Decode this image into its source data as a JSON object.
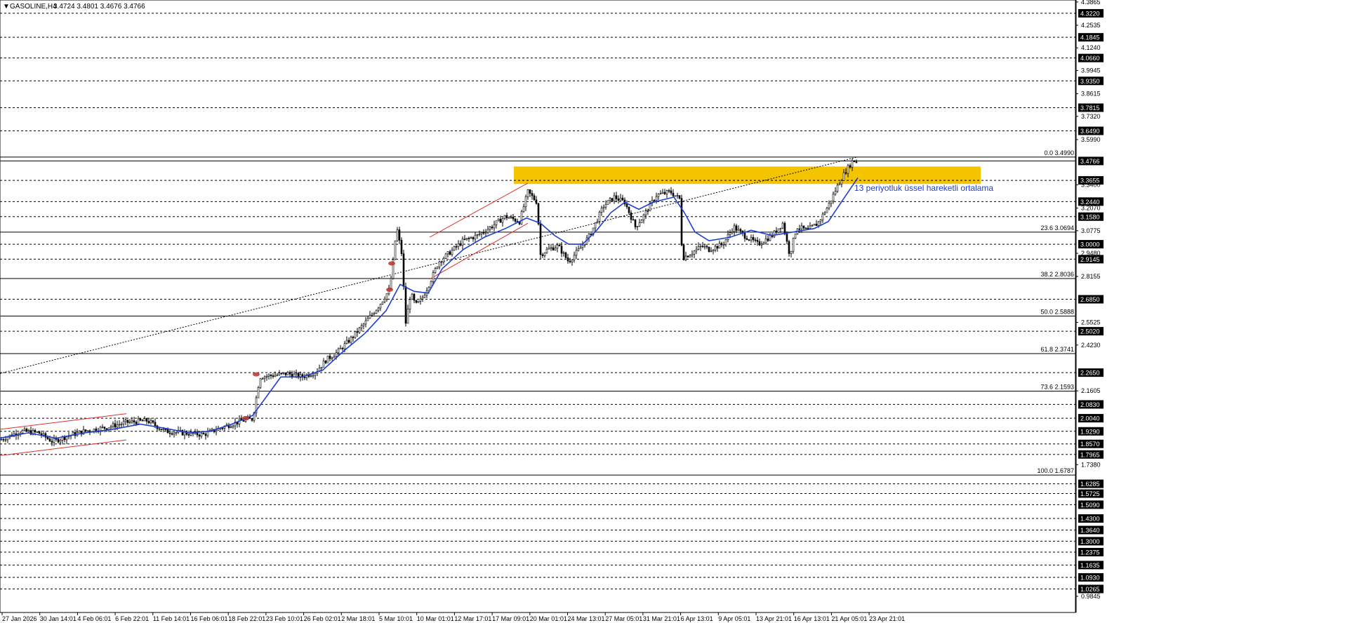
{
  "header": {
    "symbol": "GASOLINE,H4",
    "ohlc": "3.4724 3.4801 3.4676 3.4766"
  },
  "annotation": "13 periyotluk üssel hareketli ortalama",
  "colors": {
    "background": "#ffffff",
    "candle": "#000000",
    "ema": "#1f3fcf",
    "zone": "#f5c400",
    "channel": "#d9322a",
    "grid": "#000000"
  },
  "chart_data": {
    "type": "candlestick",
    "y_range": [
      0.9,
      4.39
    ],
    "price_scale_ticks": [
      "4.3865",
      "4.2535",
      "4.1240",
      "3.9945",
      "3.8615",
      "3.7320",
      "3.5990",
      "3.3400",
      "3.2070",
      "3.0775",
      "2.9480",
      "2.8155",
      "2.5525",
      "2.4230",
      "2.1605",
      "1.7380",
      "0.9845"
    ],
    "horizontal_levels": [
      {
        "price": 4.322,
        "label": "4.3220"
      },
      {
        "price": 4.1845,
        "label": "4.1845"
      },
      {
        "price": 4.066,
        "label": "4.0660"
      },
      {
        "price": 3.935,
        "label": "3.9350"
      },
      {
        "price": 3.7815,
        "label": "3.7815"
      },
      {
        "price": 3.649,
        "label": "3.6490"
      },
      {
        "price": 3.4766,
        "label": "3.4766",
        "style": "current"
      },
      {
        "price": 3.3655,
        "label": "3.3655"
      },
      {
        "price": 3.244,
        "label": "3.2440"
      },
      {
        "price": 3.158,
        "label": "3.1580"
      },
      {
        "price": 3.0,
        "label": "3.0000"
      },
      {
        "price": 2.9145,
        "label": "2.9145"
      },
      {
        "price": 2.685,
        "label": "2.6850"
      },
      {
        "price": 2.502,
        "label": "2.5020"
      },
      {
        "price": 2.265,
        "label": "2.2650"
      },
      {
        "price": 2.083,
        "label": "2.0830"
      },
      {
        "price": 2.004,
        "label": "2.0040"
      },
      {
        "price": 1.929,
        "label": "1.9290"
      },
      {
        "price": 1.857,
        "label": "1.8570"
      },
      {
        "price": 1.7965,
        "label": "1.7965"
      },
      {
        "price": 1.6285,
        "label": "1.6285"
      },
      {
        "price": 1.5725,
        "label": "1.5725"
      },
      {
        "price": 1.509,
        "label": "1.5090"
      },
      {
        "price": 1.43,
        "label": "1.4300"
      },
      {
        "price": 1.364,
        "label": "1.3640"
      },
      {
        "price": 1.3,
        "label": "1.3000"
      },
      {
        "price": 1.2375,
        "label": "1.2375"
      },
      {
        "price": 1.1635,
        "label": "1.1635"
      },
      {
        "price": 1.093,
        "label": "1.0930"
      },
      {
        "price": 1.0265,
        "label": "1.0265"
      }
    ],
    "fibonacci": [
      {
        "label": "0.0 3.4990",
        "price": 3.499
      },
      {
        "label": "23.6 3.0694",
        "price": 3.0694
      },
      {
        "label": "38.2 2.8036",
        "price": 2.8036
      },
      {
        "label": "50.0 2.5888",
        "price": 2.5888
      },
      {
        "label": "61.8 2.3741",
        "price": 2.3741
      },
      {
        "label": "73.6 2.1593",
        "price": 2.1593
      },
      {
        "label": "100.0 1.6787",
        "price": 1.6787
      }
    ],
    "resistance_zone": [
      3.345,
      3.445
    ],
    "x_labels": [
      "27 Jan 2026",
      "30 Jan 14:01",
      "4 Feb 06:01",
      "6 Feb 22:01",
      "11 Feb 14:01",
      "16 Feb 06:01",
      "18 Feb 22:01",
      "23 Feb 10:01",
      "26 Feb 02:01",
      "2 Mar 18:01",
      "5 Mar 10:01",
      "10 Mar 01:01",
      "12 Mar 17:01",
      "17 Mar 09:01",
      "20 Mar 01:01",
      "24 Mar 13:01",
      "27 Mar 05:01",
      "31 Mar 21:01",
      "6 Apr 13:01",
      "9 Apr 05:01",
      "13 Apr 21:01",
      "16 Apr 13:01",
      "21 Apr 05:01",
      "23 Apr 21:01"
    ],
    "close_path": [
      [
        0,
        1.88
      ],
      [
        30,
        1.93
      ],
      [
        55,
        1.92
      ],
      [
        75,
        1.87
      ],
      [
        95,
        1.9
      ],
      [
        120,
        1.93
      ],
      [
        150,
        1.95
      ],
      [
        180,
        1.98
      ],
      [
        210,
        1.99
      ],
      [
        235,
        1.93
      ],
      [
        260,
        1.92
      ],
      [
        290,
        1.91
      ],
      [
        315,
        1.95
      ],
      [
        345,
        1.99
      ],
      [
        360,
        2.0
      ],
      [
        370,
        2.24
      ],
      [
        390,
        2.25
      ],
      [
        410,
        2.26
      ],
      [
        430,
        2.24
      ],
      [
        450,
        2.27
      ],
      [
        465,
        2.34
      ],
      [
        480,
        2.38
      ],
      [
        500,
        2.46
      ],
      [
        520,
        2.55
      ],
      [
        540,
        2.65
      ],
      [
        555,
        2.74
      ],
      [
        560,
        2.9
      ],
      [
        565,
        3.1
      ],
      [
        572,
        2.95
      ],
      [
        578,
        2.55
      ],
      [
        585,
        2.72
      ],
      [
        592,
        2.65
      ],
      [
        600,
        2.68
      ],
      [
        610,
        2.76
      ],
      [
        625,
        2.9
      ],
      [
        640,
        2.95
      ],
      [
        660,
        3.02
      ],
      [
        680,
        3.05
      ],
      [
        700,
        3.1
      ],
      [
        720,
        3.16
      ],
      [
        740,
        3.13
      ],
      [
        752,
        3.3
      ],
      [
        765,
        3.24
      ],
      [
        770,
        2.94
      ],
      [
        780,
        2.97
      ],
      [
        795,
        2.99
      ],
      [
        810,
        2.9
      ],
      [
        825,
        2.97
      ],
      [
        840,
        3.05
      ],
      [
        860,
        3.22
      ],
      [
        875,
        3.27
      ],
      [
        890,
        3.24
      ],
      [
        905,
        3.1
      ],
      [
        915,
        3.15
      ],
      [
        935,
        3.28
      ],
      [
        955,
        3.3
      ],
      [
        968,
        3.26
      ],
      [
        972,
        2.92
      ],
      [
        985,
        2.95
      ],
      [
        1000,
        2.99
      ],
      [
        1010,
        2.97
      ],
      [
        1030,
        3.0
      ],
      [
        1045,
        3.1
      ],
      [
        1060,
        3.05
      ],
      [
        1080,
        3.0
      ],
      [
        1100,
        3.05
      ],
      [
        1115,
        3.12
      ],
      [
        1125,
        2.94
      ],
      [
        1135,
        3.1
      ],
      [
        1150,
        3.08
      ],
      [
        1165,
        3.12
      ],
      [
        1180,
        3.22
      ],
      [
        1195,
        3.35
      ],
      [
        1205,
        3.42
      ],
      [
        1215,
        3.48
      ],
      [
        1222,
        3.47
      ]
    ],
    "ema_path": [
      [
        0,
        1.89
      ],
      [
        40,
        1.92
      ],
      [
        80,
        1.89
      ],
      [
        120,
        1.92
      ],
      [
        160,
        1.94
      ],
      [
        200,
        1.97
      ],
      [
        230,
        1.95
      ],
      [
        270,
        1.92
      ],
      [
        300,
        1.93
      ],
      [
        330,
        1.97
      ],
      [
        360,
        2.02
      ],
      [
        400,
        2.24
      ],
      [
        430,
        2.24
      ],
      [
        460,
        2.28
      ],
      [
        490,
        2.39
      ],
      [
        520,
        2.49
      ],
      [
        550,
        2.62
      ],
      [
        570,
        2.77
      ],
      [
        590,
        2.73
      ],
      [
        610,
        2.72
      ],
      [
        630,
        2.86
      ],
      [
        660,
        2.97
      ],
      [
        690,
        3.04
      ],
      [
        720,
        3.09
      ],
      [
        750,
        3.15
      ],
      [
        770,
        3.12
      ],
      [
        790,
        3.05
      ],
      [
        810,
        3.0
      ],
      [
        830,
        3.0
      ],
      [
        850,
        3.08
      ],
      [
        870,
        3.18
      ],
      [
        890,
        3.24
      ],
      [
        910,
        3.2
      ],
      [
        930,
        3.24
      ],
      [
        960,
        3.27
      ],
      [
        975,
        3.18
      ],
      [
        990,
        3.07
      ],
      [
        1010,
        3.02
      ],
      [
        1040,
        3.04
      ],
      [
        1070,
        3.08
      ],
      [
        1100,
        3.05
      ],
      [
        1130,
        3.07
      ],
      [
        1160,
        3.09
      ],
      [
        1180,
        3.13
      ],
      [
        1200,
        3.25
      ],
      [
        1222,
        3.38
      ]
    ],
    "trendline": [
      [
        0,
        2.26
      ],
      [
        1222,
        3.5
      ]
    ],
    "channels": [
      {
        "upper": [
          [
            0,
            1.94
          ],
          [
            180,
            2.03
          ]
        ],
        "lower": [
          [
            0,
            1.79
          ],
          [
            180,
            1.88
          ]
        ]
      },
      {
        "upper": [
          [
            612,
            3.04
          ],
          [
            752,
            3.35
          ]
        ],
        "lower": [
          [
            612,
            2.8
          ],
          [
            752,
            3.12
          ]
        ]
      }
    ],
    "reversal_markers": [
      [
        350,
        2.005
      ],
      [
        365,
        2.255
      ],
      [
        558,
        2.89
      ],
      [
        555,
        2.74
      ]
    ]
  }
}
